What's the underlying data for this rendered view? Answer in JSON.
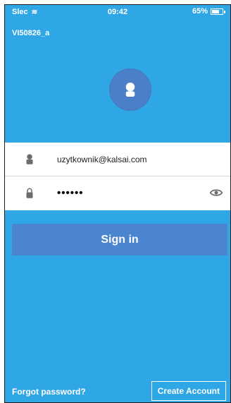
{
  "status_bar": {
    "carrier": "Slec",
    "time": "09:42",
    "battery_percent": "65%"
  },
  "device": {
    "name": "VI50826_a"
  },
  "login": {
    "username": "uzytkownik@kalsai.com",
    "password_masked": "••••••",
    "sign_in_label": "Sign in",
    "forgot_label": "Forgot password?",
    "create_label": "Create Account"
  },
  "colors": {
    "background": "#2fa6e6",
    "button": "#4b85cf",
    "avatar": "#4b7fc7"
  },
  "icons": {
    "avatar": "user-avatar-icon",
    "user": "user-icon",
    "lock": "lock-icon",
    "eye": "eye-icon",
    "wifi": "wifi-icon",
    "battery": "battery-icon"
  }
}
